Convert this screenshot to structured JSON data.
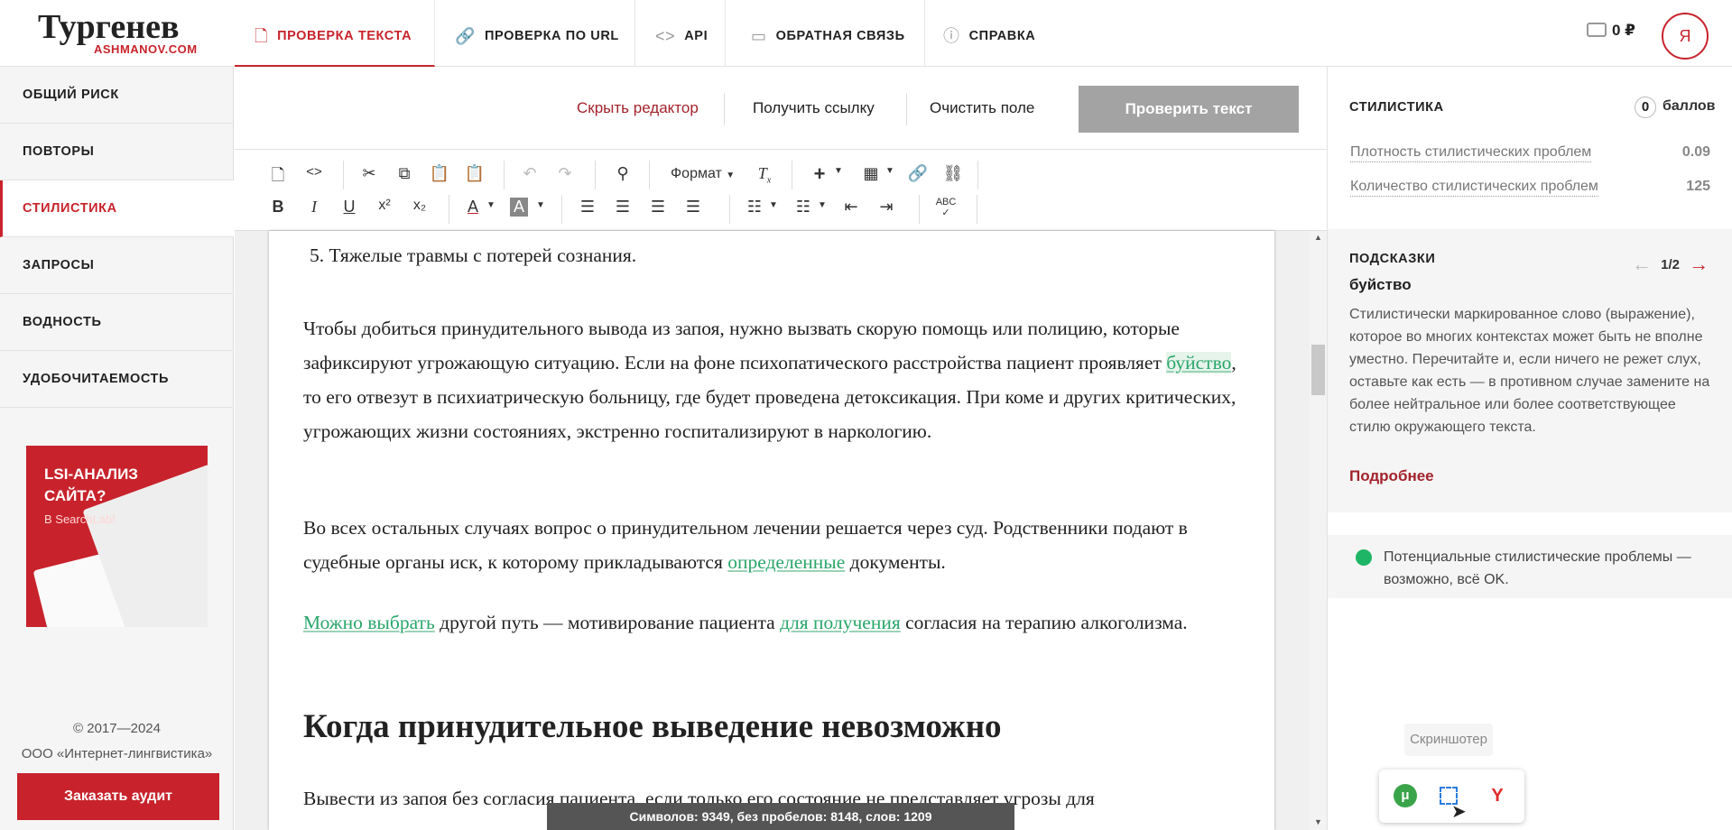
{
  "app": {
    "logo_title": "Тургенев",
    "logo_subtitle": "ASHMANOV.COM"
  },
  "sidebar": {
    "items": [
      {
        "label": "ОБЩИЙ РИСК"
      },
      {
        "label": "ПОВТОРЫ"
      },
      {
        "label": "СТИЛИСТИКА",
        "active": true
      },
      {
        "label": "ЗАПРОСЫ"
      },
      {
        "label": "ВОДНОСТЬ"
      },
      {
        "label": "УДОБОЧИТАЕМОСТЬ"
      }
    ],
    "banner": {
      "title_line1": "LSI-АНАЛИЗ",
      "title_line2": "САЙТА?",
      "subtitle": "В SearchLab!"
    },
    "copyright": "© 2017—2024",
    "company": "ООО «Интернет-лингвистика»",
    "audit_button": "Заказать аудит"
  },
  "tabs": [
    {
      "label": "ПРОВЕРКА ТЕКСТА",
      "icon": "document-icon",
      "active": true
    },
    {
      "label": "ПРОВЕРКА ПО URL",
      "icon": "link-icon"
    },
    {
      "label": "API",
      "icon": "code-icon"
    },
    {
      "label": "ОБРАТНАЯ СВЯЗЬ",
      "icon": "message-icon"
    },
    {
      "label": "СПРАВКА",
      "icon": "info-icon"
    }
  ],
  "header": {
    "balance": "0 ₽",
    "avatar_letter": "Я"
  },
  "editor_actions": {
    "hide_editor": "Скрыть редактор",
    "get_link": "Получить ссылку",
    "clear_field": "Очистить поле",
    "check_text": "Проверить текст"
  },
  "toolbar": {
    "format_label": "Формат"
  },
  "document": {
    "list_item": "5. Тяжелые травмы с потерей сознания.",
    "p1": {
      "a": "Чтобы добиться принудительного вывода из запоя, нужно вызвать скорую помощь или полицию, которые зафиксируют угрожающую ситуацию. Если на фоне психопатического расстройства пациент проявляет ",
      "hl": "буйство",
      "b": ", то его отвезут в психиатрическую больницу, где будет проведена детоксикация. При коме и других критических, угрожающих жизни состояниях, экстренно госпитализируют в наркологию."
    },
    "p2": {
      "a": "Во всех остальных случаях вопрос о принудительном лечении решается через суд. Родственники подают в судебные органы иск, к которому прикладываются ",
      "hl": "определенные",
      "b": " документы."
    },
    "p3": {
      "hl1": "Можно выбрать",
      "a": " другой путь — мотивирование пациента ",
      "hl2": "для получения",
      "b": " согласия на терапию алкоголизма."
    },
    "heading": "Когда принудительное выведение невозможно",
    "p4": "Вывести из запоя без согласия пациента, если только его состояние не представляет угрозы для",
    "counter": "Символов: 9349, без пробелов: 8148, слов: 1209"
  },
  "right_panel": {
    "stylistics_title": "СТИЛИСТИКА",
    "score": "0",
    "score_label": "баллов",
    "metrics": [
      {
        "label": "Плотность стилистических проблем",
        "value": "0.09"
      },
      {
        "label": "Количество стилистических проблем",
        "value": "125"
      }
    ],
    "hints_title": "ПОДСКАЗКИ",
    "hint_pager": "1/2",
    "hint_word": "буйство",
    "hint_text": "Стилистически маркированное слово (выражение), которое во многих контекстах может быть не вполне уместно. Перечитайте и, если ничего не режет слух, оставьте как есть — в противном случае замените на более нейтральное или более соответствующее стилю окружающего текста.",
    "more_link": "Подробнее",
    "status_text": "Потенциальные стилистические проблемы — возможно, всё OK."
  },
  "overlay": {
    "tooltip": "Скриншотер"
  },
  "colors": {
    "accent": "#c8232c",
    "highlight": "#2aa66a",
    "status_ok": "#1fb566"
  }
}
